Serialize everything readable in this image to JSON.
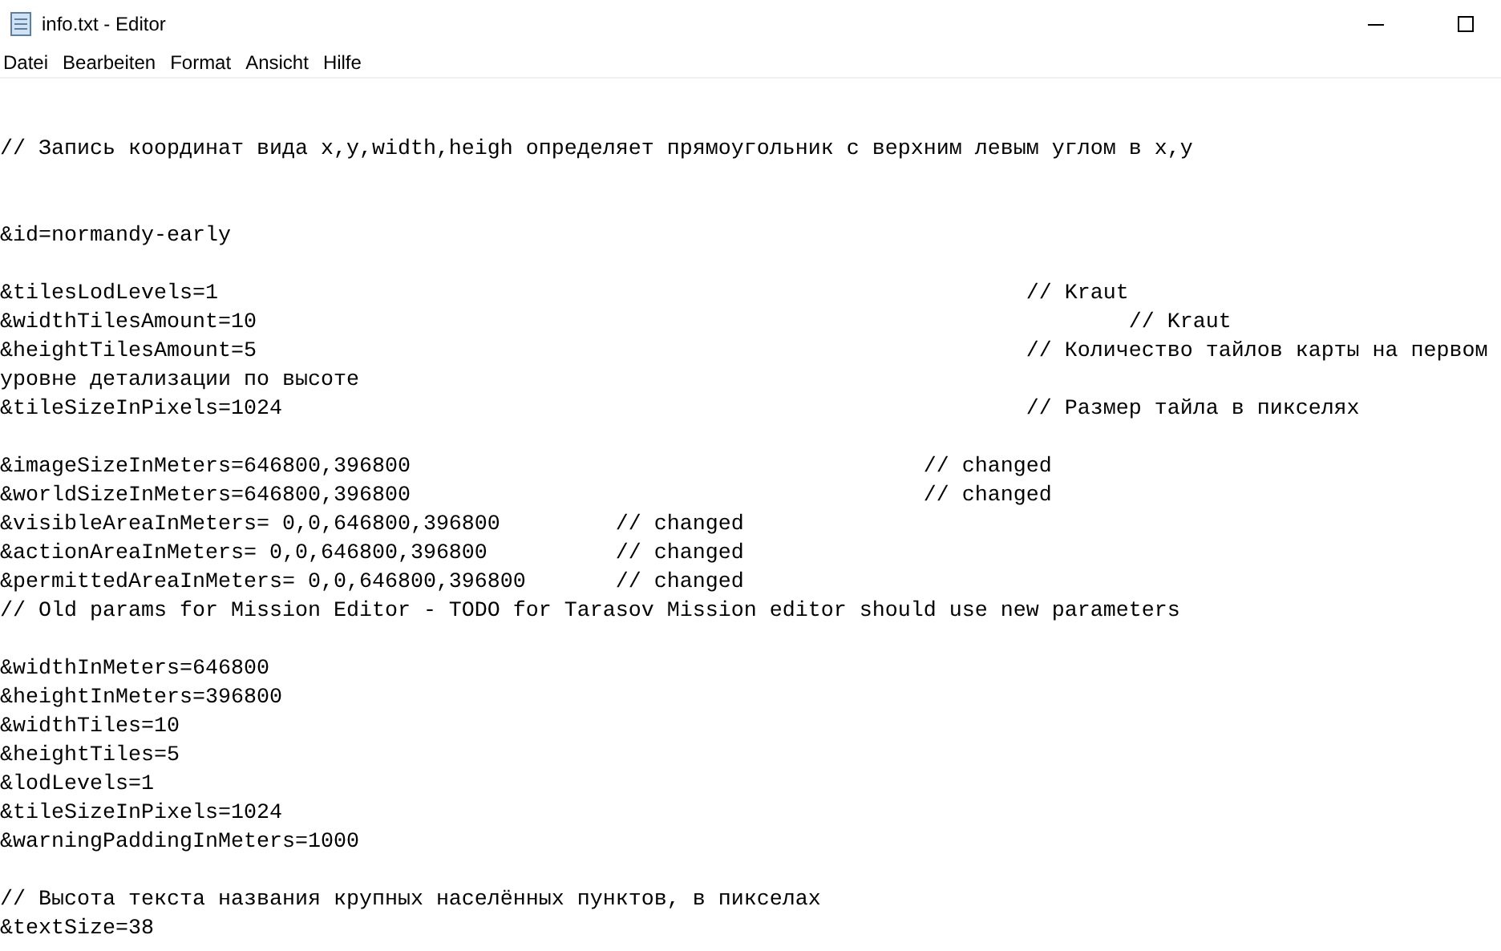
{
  "window": {
    "title": "info.txt - Editor"
  },
  "menu": [
    {
      "label": "Datei"
    },
    {
      "label": "Bearbeiten"
    },
    {
      "label": "Format"
    },
    {
      "label": "Ansicht"
    },
    {
      "label": "Hilfe"
    }
  ],
  "lines": [
    {
      "kind": "blank"
    },
    {
      "kind": "blank"
    },
    {
      "kind": "text",
      "text": "// Запись координат вида x,y,width,heigh определяет прямоугольник с верхним левым углом в x,y"
    },
    {
      "kind": "blank"
    },
    {
      "kind": "blank"
    },
    {
      "kind": "text",
      "text": "&id=normandy-early"
    },
    {
      "kind": "blank"
    },
    {
      "kind": "text",
      "text": "&tilesLodLevels=1                                                               // Kraut"
    },
    {
      "kind": "text",
      "text": "&widthTilesAmount=10                                                                    // Kraut"
    },
    {
      "kind": "text",
      "text": "&heightTilesAmount=5                                                            // Количество тайлов карты на первом"
    },
    {
      "kind": "text",
      "text": "уровне детализации по высоте"
    },
    {
      "kind": "text",
      "text": "&tileSizeInPixels=1024                                                          // Размер тайла в пикселях"
    },
    {
      "kind": "blank"
    },
    {
      "kind": "text",
      "text": "&imageSizeInMeters=646800,396800                                        // changed"
    },
    {
      "kind": "text",
      "text": "&worldSizeInMeters=646800,396800                                        // changed"
    },
    {
      "kind": "text",
      "text": "&visibleAreaInMeters= 0,0,646800,396800         // changed"
    },
    {
      "kind": "text",
      "text": "&actionAreaInMeters= 0,0,646800,396800          // changed"
    },
    {
      "kind": "text",
      "text": "&permittedAreaInMeters= 0,0,646800,396800       // changed"
    },
    {
      "kind": "text",
      "text": "// Old params for Mission Editor - TODO for Tarasov Mission editor should use new parameters"
    },
    {
      "kind": "blank"
    },
    {
      "kind": "text",
      "text": "&widthInMeters=646800"
    },
    {
      "kind": "text",
      "text": "&heightInMeters=396800"
    },
    {
      "kind": "text",
      "text": "&widthTiles=10"
    },
    {
      "kind": "text",
      "text": "&heightTiles=5"
    },
    {
      "kind": "text",
      "text": "&lodLevels=1"
    },
    {
      "kind": "text",
      "text": "&tileSizeInPixels=1024"
    },
    {
      "kind": "text",
      "text": "&warningPaddingInMeters=1000"
    },
    {
      "kind": "blank"
    },
    {
      "kind": "text",
      "text": "// Высота текста названия крупных населённых пунктов, в пикселах"
    },
    {
      "kind": "text",
      "text": "&textSize=38"
    }
  ]
}
